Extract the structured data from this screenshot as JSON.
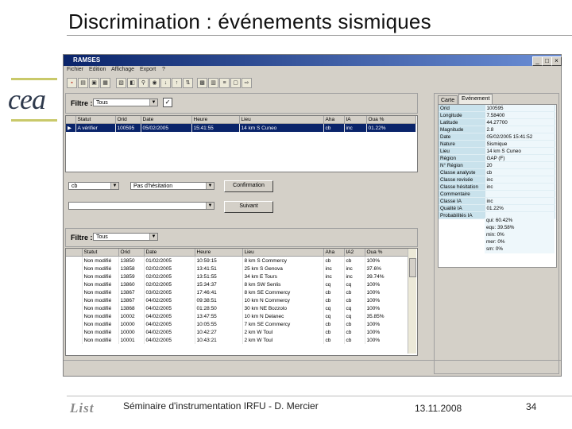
{
  "slide": {
    "title": "Discrimination : événements sismiques",
    "footer_left": "Séminaire d'instrumentation IRFU - D. Mercier",
    "footer_date": "13.11.2008",
    "page_number": "34",
    "logo_text": "cea",
    "footer_logo": "List"
  },
  "app": {
    "window_title": "RAMSES",
    "menus": [
      "Fichier",
      "Edition",
      "Affichage",
      "Export",
      "?"
    ],
    "top_filter": {
      "label": "Filtre :",
      "value": "Tous"
    },
    "top_table": {
      "headers": [
        "Statut",
        "Orid",
        "Date",
        "Heure",
        "Lieu",
        "Aha",
        "IA",
        "Oua %"
      ],
      "rows": [
        [
          "A vérifier",
          "100595",
          "05/02/2005",
          "15:41:55",
          "14 km S Cuneo",
          "cb",
          "inc",
          "01.22%"
        ]
      ]
    },
    "mid_combo_1": "cb",
    "mid_combo_2": "Pas d'hésitation",
    "mid_combo_3": "",
    "btn_validate": "Confirmation",
    "btn_next": "Suivant",
    "bottom_filter": {
      "label": "Filtre :",
      "value": "Tous"
    },
    "bottom_table": {
      "headers": [
        "Statut",
        "Orid",
        "Date",
        "Heure",
        "Lieu",
        "Aha",
        "IA2",
        "Oua %"
      ],
      "rows": [
        [
          "Non modifié",
          "13850",
          "01/02/2005",
          "10:59:15",
          "8 km S Commercy",
          "cb",
          "cb",
          "100%"
        ],
        [
          "Non modifié",
          "13858",
          "02/02/2005",
          "13:41:51",
          "25 km S Genova",
          "inc",
          "inc",
          "37.6%"
        ],
        [
          "Non modifié",
          "13859",
          "02/02/2005",
          "13:51:55",
          "34 km E Tours",
          "inc",
          "inc",
          "39.74%"
        ],
        [
          "Non modifié",
          "13860",
          "02/02/2005",
          "15:34:37",
          "8 km SW Senlis",
          "cq",
          "cq",
          "100%"
        ],
        [
          "Non modifié",
          "13867",
          "03/02/2005",
          "17:46:41",
          "8 km SE Commercy",
          "cb",
          "cb",
          "100%"
        ],
        [
          "Non modifié",
          "13867",
          "04/02/2005",
          "09:38:51",
          "10 km N Commercy",
          "cb",
          "cb",
          "100%"
        ],
        [
          "Non modifié",
          "13868",
          "04/02/2005",
          "01:28:50",
          "30 km NE Bozzolo",
          "cq",
          "cq",
          "100%"
        ],
        [
          "Non modifié",
          "10002",
          "04/02/2005",
          "13:47:55",
          "10 km N Delanec",
          "cq",
          "cq",
          "35.85%"
        ],
        [
          "Non modifié",
          "10000",
          "04/02/2005",
          "10:05:55",
          "7 km SE Commercy",
          "cb",
          "cb",
          "100%"
        ],
        [
          "Non modifié",
          "10000",
          "04/02/2005",
          "10:42:27",
          "2 km W Toul",
          "cb",
          "cb",
          "100%"
        ],
        [
          "Non modifié",
          "10001",
          "04/02/2005",
          "10:43:21",
          "2 km W Toul",
          "cb",
          "cb",
          "100%"
        ]
      ]
    },
    "tabs": [
      "Carte",
      "Evénement"
    ],
    "properties": [
      [
        "Orid",
        "100595"
      ],
      [
        "Longitude",
        "7.58400"
      ],
      [
        "Latitude",
        "44.27700"
      ],
      [
        "Magnitude",
        "2.8"
      ],
      [
        "Date",
        "05/02/2005 15:41:52"
      ],
      [
        "Nature",
        "Sismique"
      ],
      [
        "Lieu",
        "14 km S Cuneo"
      ],
      [
        "Région",
        "GAP (F)"
      ],
      [
        "N° Région",
        "20"
      ],
      [
        "Classe analyste",
        "cb"
      ],
      [
        "Classe revisée",
        "inc"
      ],
      [
        "Classe hésitation",
        "inc"
      ],
      [
        "Commentaire",
        ""
      ],
      [
        "Classe IA",
        "inc"
      ],
      [
        "Qualité IA",
        "01.22%"
      ],
      [
        "Probabilités IA",
        ""
      ]
    ],
    "probabilities": [
      "qui: 60.42%",
      "equ: 39.58%",
      "min: 0%",
      "mer: 0%",
      "sm: 0%"
    ]
  }
}
